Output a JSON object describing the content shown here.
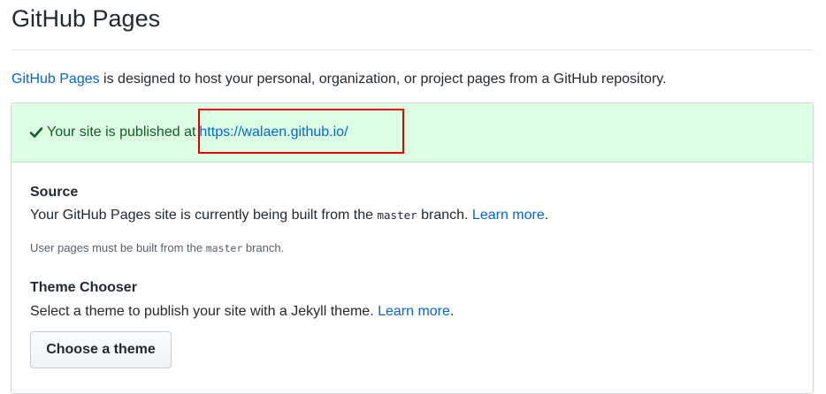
{
  "page": {
    "title": "GitHub Pages",
    "intro_link": "GitHub Pages",
    "intro_text": " is designed to host your personal, organization, or project pages from a GitHub repository."
  },
  "status": {
    "message": "Your site is published at",
    "url": "https://walaen.github.io/",
    "icon": "check-icon",
    "color": "#dcffe4"
  },
  "source": {
    "title": "Source",
    "text_before": "Your GitHub Pages site is currently being built from the ",
    "branch": "master",
    "text_after": " branch. ",
    "learn_more": "Learn more",
    "period": ".",
    "note_before": "User pages must be built from the ",
    "note_branch": "master",
    "note_after": " branch."
  },
  "theme": {
    "title": "Theme Chooser",
    "text": "Select a theme to publish your site with a Jekyll theme. ",
    "learn_more": "Learn more",
    "period": ".",
    "button_label": "Choose a theme"
  }
}
